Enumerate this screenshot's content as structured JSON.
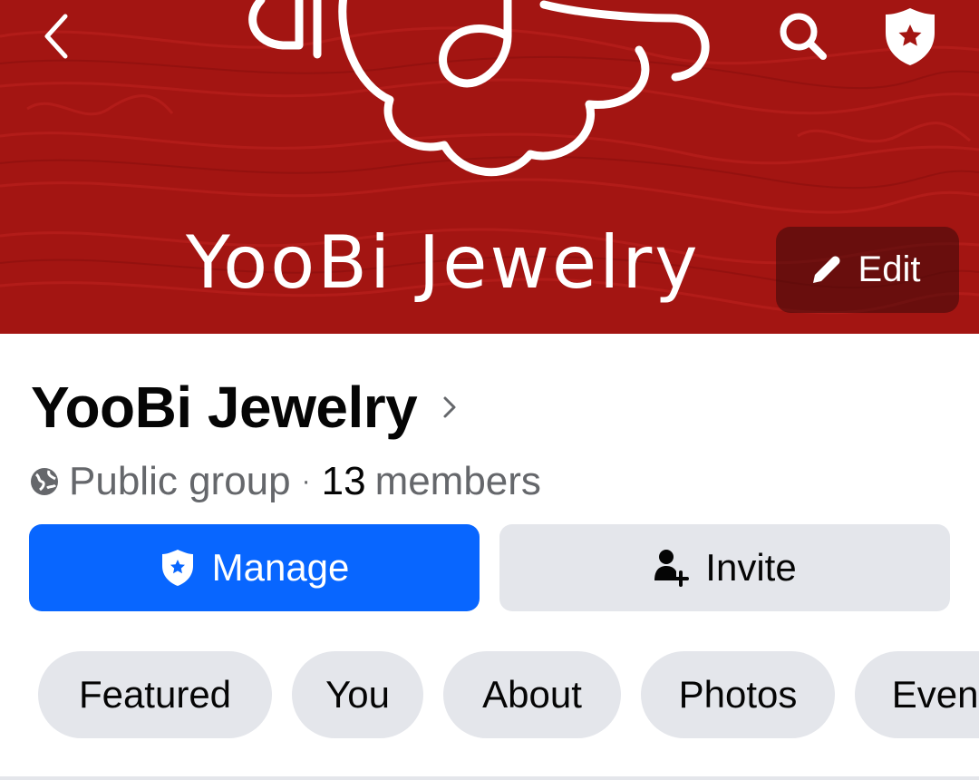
{
  "cover": {
    "title": "YooBi Jewelry",
    "edit_label": "Edit",
    "background_color": "#a31512"
  },
  "header_icons": {
    "back": "chevron-left-icon",
    "search": "search-icon",
    "admin": "admin-shield-icon"
  },
  "group": {
    "name": "YooBi Jewelry",
    "privacy": "Public group",
    "separator": "·",
    "member_count": "13",
    "member_label": "members"
  },
  "actions": {
    "manage_label": "Manage",
    "invite_label": "Invite",
    "manage_color": "#0866ff",
    "invite_color": "#e4e6eb"
  },
  "tabs": [
    {
      "label": "Featured"
    },
    {
      "label": "You"
    },
    {
      "label": "About"
    },
    {
      "label": "Photos"
    },
    {
      "label": "Events"
    }
  ]
}
